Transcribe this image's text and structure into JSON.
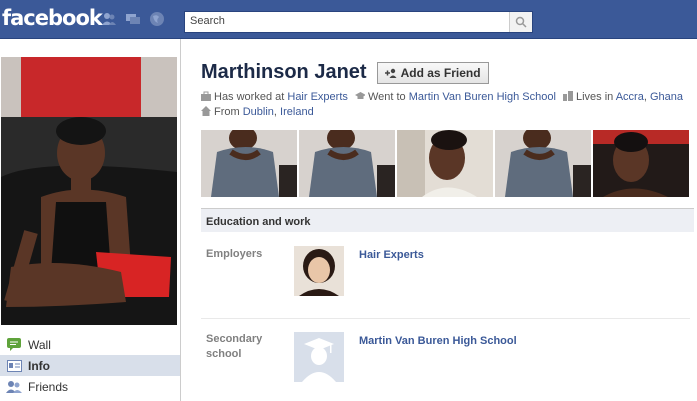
{
  "header": {
    "logo": "facebook",
    "search_placeholder": "Search"
  },
  "sidebar": {
    "items": [
      {
        "label": "Wall",
        "icon": "wall-icon"
      },
      {
        "label": "Info",
        "icon": "info-icon",
        "active": true
      },
      {
        "label": "Friends",
        "icon": "friends-icon"
      }
    ]
  },
  "profile": {
    "name": "Marthinson Janet",
    "add_friend_label": "Add as Friend",
    "facts": {
      "worked_prefix": "Has worked at",
      "worked_place": "Hair Experts",
      "went_prefix": "Went to",
      "school": "Martin Van Buren High School",
      "lives_prefix": "Lives in",
      "city": "Accra",
      "country": "Ghana",
      "from_prefix": "From",
      "from_city": "Dublin",
      "from_country": "Ireland"
    }
  },
  "education": {
    "header": "Education and work",
    "employers_label": "Employers",
    "employer_name": "Hair Experts",
    "secondary_label_1": "Secondary",
    "secondary_label_2": "school",
    "school_name": "Martin Van Buren High School"
  },
  "colors": {
    "brand": "#3b5998",
    "link": "#3b5998",
    "section_bg": "#edeff4"
  }
}
